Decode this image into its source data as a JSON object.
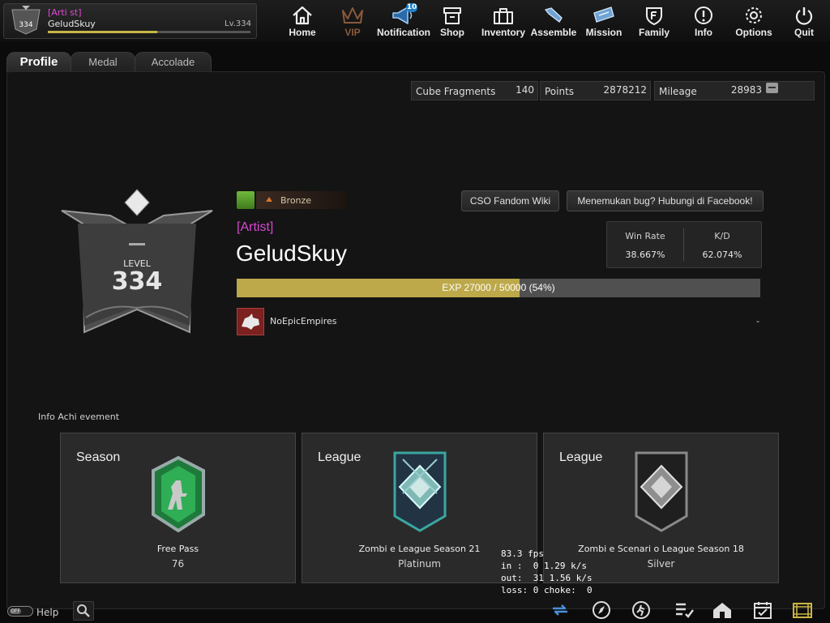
{
  "player": {
    "title": "[Arti st]",
    "name": "GeludSkuy",
    "level": "Lv.334",
    "emblem_level": "334"
  },
  "nav": [
    {
      "id": "home",
      "label": "Home",
      "icon": "home-icon"
    },
    {
      "id": "vip",
      "label": "VIP",
      "icon": "crown-icon"
    },
    {
      "id": "notification",
      "label": "Notification",
      "icon": "megaphone-icon",
      "badge": "10"
    },
    {
      "id": "shop",
      "label": "Shop",
      "icon": "shop-icon"
    },
    {
      "id": "inventory",
      "label": "Inventory",
      "icon": "briefcase-icon"
    },
    {
      "id": "assemble",
      "label": "Assemble",
      "icon": "wrench-icon"
    },
    {
      "id": "mission",
      "label": "Mission",
      "icon": "ticket-icon"
    },
    {
      "id": "family",
      "label": "Family",
      "icon": "family-shield-icon"
    },
    {
      "id": "info",
      "label": "Info",
      "icon": "info-icon"
    },
    {
      "id": "options",
      "label": "Options",
      "icon": "gear-icon"
    },
    {
      "id": "quit",
      "label": "Quit",
      "icon": "power-icon"
    }
  ],
  "tabs": [
    {
      "label": "Profile"
    },
    {
      "label": "Medal"
    },
    {
      "label": "Accolade"
    }
  ],
  "currencies": [
    {
      "label": "Cube Fragments",
      "value": "140"
    },
    {
      "label": "Points",
      "value": "2878212"
    },
    {
      "label": "Mileage",
      "value": "28983"
    }
  ],
  "profile": {
    "rank": "Bronze",
    "buttons": [
      "CSO Fandom Wiki",
      "Menemukan bug? Hubungi di Facebook!"
    ],
    "title": "[Artist]",
    "name": "GeludSkuy",
    "emblem_caption": "LEVEL",
    "emblem_level": "334",
    "stats": [
      {
        "label": "Win Rate",
        "value": "38.667%"
      },
      {
        "label": "K/D",
        "value": "62.074%"
      }
    ],
    "exp": {
      "text": "EXP 27000 / 50000 (54%)",
      "progress": 0.54
    },
    "clan": {
      "name": "NoEpicEmpires",
      "extra": "-"
    }
  },
  "achievements": {
    "header": "Info Achi evement",
    "cards": [
      {
        "category": "Season",
        "name": "Free Pass",
        "value": "76",
        "badge": "green-soldier-emblem"
      },
      {
        "category": "League",
        "name": "Zombi e League Season 21",
        "value": "Platinum",
        "badge": "platinum-league-emblem"
      },
      {
        "category": "League",
        "name": "Zombi e Scenari o League Season 18",
        "value": "Silver",
        "badge": "silver-league-emblem"
      }
    ]
  },
  "netgraph": {
    "fps": "83.3 fps",
    "in": "in :  0 1.29 k/s",
    "out": "out:  31 1.56 k/s",
    "loss": "loss: 0 choke:  0"
  },
  "bottom": {
    "help_label": "Help",
    "toggle_label": "OFF",
    "icons": [
      "sync-icon",
      "compass-icon",
      "runner-icon",
      "checklist-icon",
      "house-icon",
      "calendar-check-icon",
      "film-icon"
    ]
  },
  "colors": {
    "accent_gold": "#bda94a",
    "title_magenta": "#d648d0",
    "rank_bronze": "#d7752e"
  }
}
